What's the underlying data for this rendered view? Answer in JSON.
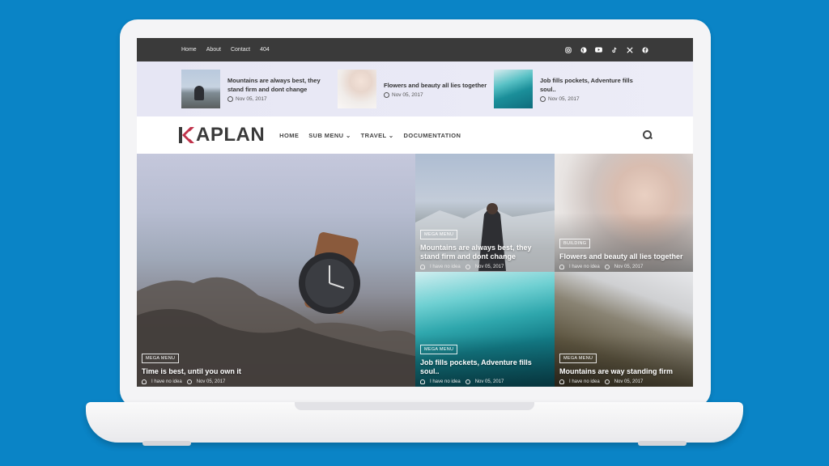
{
  "top_nav": [
    "Home",
    "About",
    "Contact",
    "404"
  ],
  "social_icons": [
    "instagram-icon",
    "pinterest-icon",
    "youtube-icon",
    "tiktok-icon",
    "x-icon",
    "facebook-icon"
  ],
  "ticker": [
    {
      "title": "Mountains are always best, they stand firm and dont change",
      "date": "Nov 05, 2017"
    },
    {
      "title": "Flowers and beauty all lies together",
      "date": "Nov 05, 2017"
    },
    {
      "title": "Job fills pockets, Adventure fills soul..",
      "date": "Nov 05, 2017"
    }
  ],
  "logo": "APLAN",
  "main_nav": [
    "HOME",
    "SUB MENU",
    "TRAVEL",
    "DOCUMENTATION"
  ],
  "featured": {
    "tag": "MEGA MENU",
    "title": "Time is best, until you own it",
    "author": "I have no idea",
    "date": "Nov 05, 2017"
  },
  "cards": [
    {
      "tag": "MEGA MENU",
      "title": "Mountains are always best, they stand firm and dont change",
      "author": "I have no idea",
      "date": "Nov 05, 2017"
    },
    {
      "tag": "BUILDING",
      "title": "Flowers and beauty all lies together",
      "author": "I have no idea",
      "date": "Nov 05, 2017"
    },
    {
      "tag": "MEGA MENU",
      "title": "Job fills pockets, Adventure fills soul..",
      "author": "I have no idea",
      "date": "Nov 05, 2017"
    },
    {
      "tag": "MEGA MENU",
      "title": "Mountains are way standing firm",
      "author": "I have no idea",
      "date": "Nov 05, 2017"
    }
  ],
  "colors": {
    "background": "#0a84c6",
    "topbar": "#3a3a3a",
    "logo_accent": "#c0324a"
  }
}
